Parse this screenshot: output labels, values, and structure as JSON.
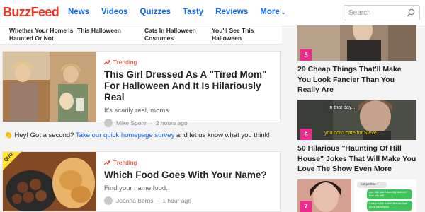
{
  "header": {
    "logo": "BuzzFeed",
    "nav": [
      "News",
      "Videos",
      "Quizzes",
      "Tasty",
      "Reviews",
      "More"
    ],
    "search_placeholder": "Search"
  },
  "top_strip": [
    {
      "label": "Whether Your Home Is Haunted Or Not"
    },
    {
      "label": "This Halloween"
    },
    {
      "label": "Cats In Halloween Costumes"
    },
    {
      "label": "You'll See This Halloween"
    }
  ],
  "feed": [
    {
      "trend_label": "Trending",
      "headline": "This Girl Dressed As A \"Tired Mom\" For Halloween And It Is Hilariously Real",
      "description": "It's scarily real, moms.",
      "author": "Mike Spohr",
      "time": "2 hours ago"
    },
    {
      "badge": "QUIZ",
      "trend_label": "Trending",
      "headline": "Which Food Goes With Your Name?",
      "description": "Find your name food.",
      "author": "Joanna Borns",
      "time": "1 hour ago"
    }
  ],
  "survey": {
    "emoji": "👏",
    "lead": "Hey! Got a second?",
    "link": "Take our quick homepage survey",
    "tail": "and let us know what you think!"
  },
  "sidebar": [
    {
      "num": "5",
      "title": "29 Cheap Things That'll Make You Look Fancier Than You Really Are"
    },
    {
      "num": "6",
      "title": "50 Hilarious \"Haunting Of Hill House\" Jokes That Will Make You Love The Show Even More",
      "caption_top": "in that day...",
      "caption_bottom": "you don't care for Steve."
    },
    {
      "num": "7",
      "chat": [
        "not perfect.",
        "you still didn't actually ask me that you still",
        "I want to be in him like the feel more interested"
      ]
    }
  ],
  "colors": {
    "brand": "#ee3322",
    "link": "#0f65ef",
    "rank": "#ed2b8f"
  }
}
